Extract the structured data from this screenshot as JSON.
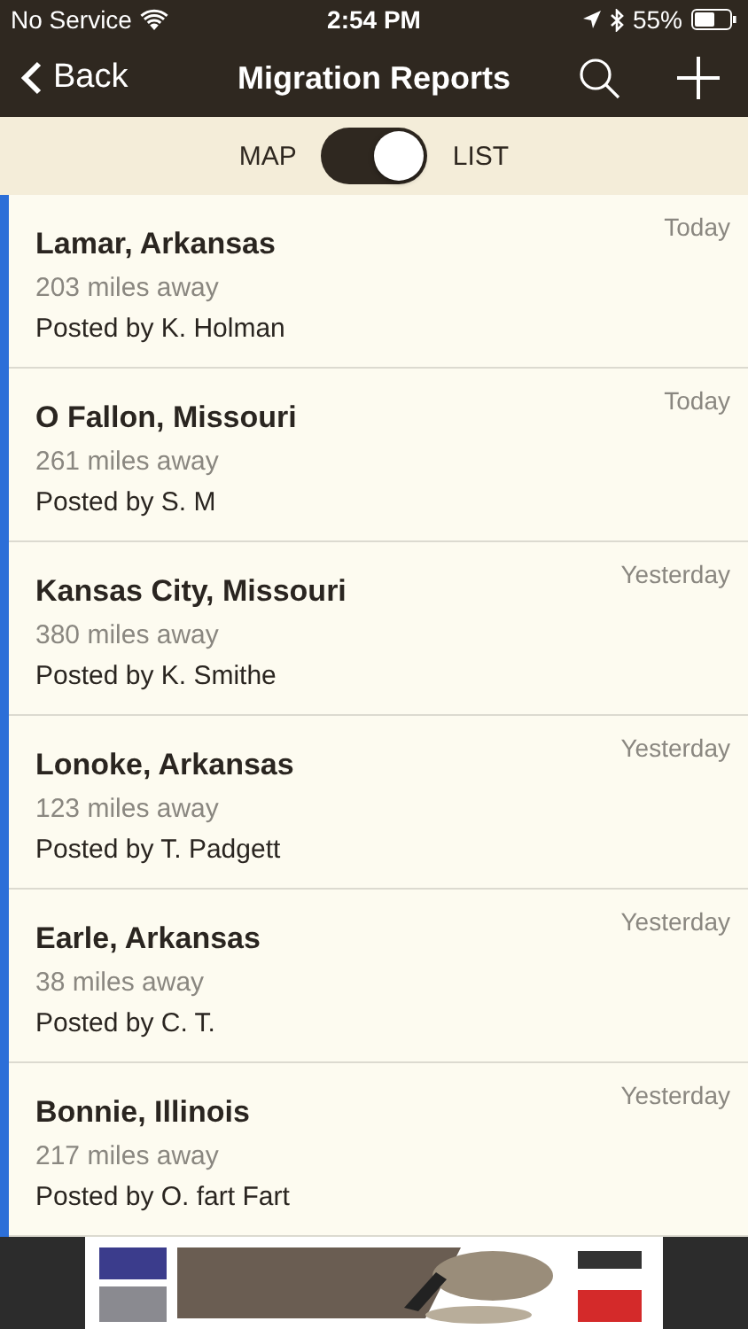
{
  "status_bar": {
    "carrier": "No Service",
    "time": "2:54 PM",
    "battery": "55%"
  },
  "nav_bar": {
    "back": "Back",
    "title": "Migration Reports"
  },
  "view_toggle": {
    "left_label": "MAP",
    "right_label": "LIST",
    "on": true
  },
  "reports": [
    {
      "location": "Lamar, Arkansas",
      "distance": "203 miles away",
      "posted_by": "Posted by K. Holman",
      "date": "Today"
    },
    {
      "location": "O Fallon, Missouri",
      "distance": "261 miles away",
      "posted_by": "Posted by S. M",
      "date": "Today"
    },
    {
      "location": "Kansas City, Missouri",
      "distance": "380 miles away",
      "posted_by": "Posted by K. Smithe",
      "date": "Yesterday"
    },
    {
      "location": "Lonoke, Arkansas",
      "distance": "123 miles away",
      "posted_by": "Posted by T. Padgett",
      "date": "Yesterday"
    },
    {
      "location": "Earle, Arkansas",
      "distance": "38 miles away",
      "posted_by": "Posted by C. T.",
      "date": "Yesterday"
    },
    {
      "location": "Bonnie, Illinois",
      "distance": "217 miles away",
      "posted_by": "Posted by O. fart Fart",
      "date": "Yesterday"
    }
  ]
}
